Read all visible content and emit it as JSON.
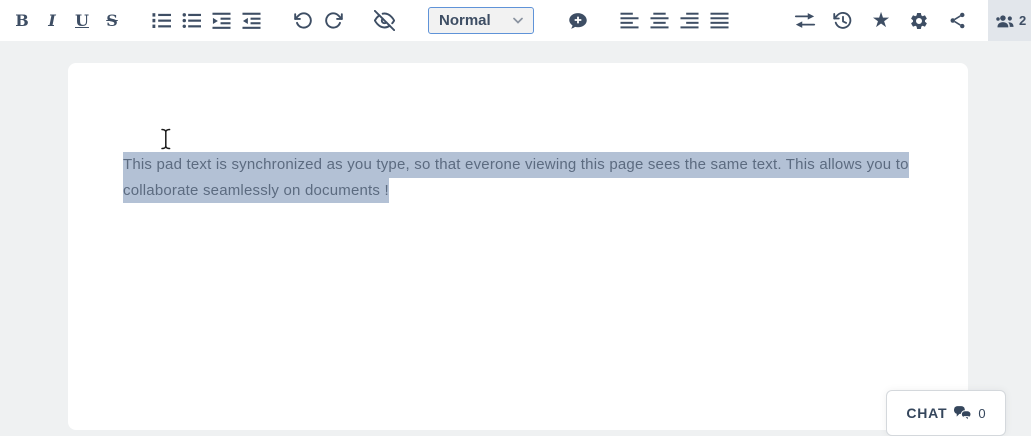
{
  "toolbar": {
    "bold_label": "B",
    "italic_label": "I",
    "underline_label": "U",
    "strikethrough_label": "S",
    "style_dropdown_value": "Normal",
    "star_glyph": "★",
    "users_count": "2"
  },
  "editor": {
    "lines": [
      "This pad text is synchronized as you type, so that everone viewing this page sees the same text. This allows you to",
      "collaborate seamlessly on documents !"
    ]
  },
  "chat": {
    "label": "CHAT",
    "count": "0"
  },
  "colors": {
    "icon": "#3e4e64",
    "selection_highlight": "#b3c1d5",
    "editor_text": "#5c6b80",
    "dropdown_border": "#5f93d8",
    "canvas_background": "#eff1f2",
    "page_background": "#ffffff",
    "users_button_background": "#e2e6eb"
  }
}
